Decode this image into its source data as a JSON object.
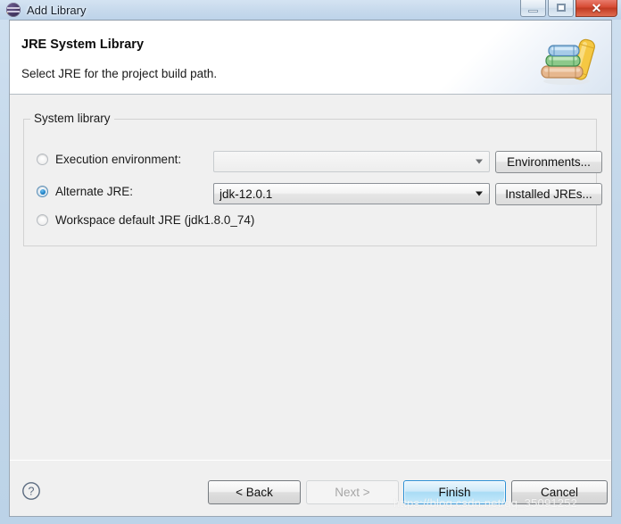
{
  "window": {
    "title": "Add Library",
    "app_icon": "eclipse-icon",
    "controls": {
      "minimize": "minimize-button",
      "maximize": "maximize-button",
      "close": "close-button",
      "close_glyph": "✕"
    }
  },
  "banner": {
    "title": "JRE System Library",
    "subtitle": "Select JRE for the project build path.",
    "icon": "books-stack-icon"
  },
  "group": {
    "legend": "System library",
    "options": [
      {
        "id": "execution-environment",
        "label": "Execution environment:",
        "selected": false,
        "combo": {
          "value": "",
          "placeholder": "",
          "enabled": false
        },
        "button": "Environments..."
      },
      {
        "id": "alternate-jre",
        "label": "Alternate JRE:",
        "selected": true,
        "combo": {
          "value": "jdk-12.0.1",
          "placeholder": "",
          "enabled": true
        },
        "button": "Installed JREs..."
      },
      {
        "id": "workspace-default-jre",
        "label": "Workspace default JRE (jdk1.8.0_74)",
        "selected": false
      }
    ]
  },
  "footer": {
    "help": "help-icon",
    "back": "< Back",
    "next": "Next >",
    "finish": "Finish",
    "cancel": "Cancel"
  },
  "watermark": "https://blog.csdn.net/qq_35091252",
  "colors": {
    "accent": "#2a8fd4",
    "titlebar": "#c6d9ec",
    "dialog_bg": "#f0f0f0",
    "close_red": "#d64b33"
  }
}
